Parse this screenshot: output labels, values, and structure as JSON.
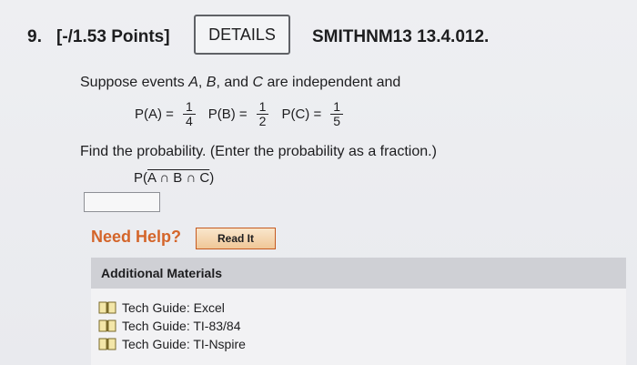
{
  "question": {
    "number": "9.",
    "points": "[-/1.53 Points]",
    "details_label": "DETAILS",
    "code": "SMITHNM13 13.4.012."
  },
  "prompt": {
    "pre": "Suppose events ",
    "A": "A",
    "sep1": ", ",
    "B": "B",
    "sep2": ", and ",
    "C": "C",
    "post": " are independent and"
  },
  "probabilities": [
    {
      "label": "P(A) =",
      "numerator": "1",
      "denominator": "4"
    },
    {
      "label": "P(B) =",
      "numerator": "1",
      "denominator": "2"
    },
    {
      "label": "P(C) =",
      "numerator": "1",
      "denominator": "5"
    }
  ],
  "instruction": "Find the probability. (Enter the probability as a fraction.)",
  "expression": {
    "prefix": "P(",
    "overlined": "A ∩ B ∩ C",
    "suffix": ")"
  },
  "answer": {
    "value": ""
  },
  "help": {
    "label": "Need Help?",
    "read_it": "Read It"
  },
  "materials": {
    "header": "Additional Materials",
    "items": [
      {
        "label": "Tech Guide: Excel",
        "icon": "book-icon"
      },
      {
        "label": "Tech Guide: TI-83/84",
        "icon": "book-icon"
      },
      {
        "label": "Tech Guide: TI-Nspire",
        "icon": "book-icon"
      }
    ]
  },
  "colors": {
    "accent": "#d4652a",
    "header_bg": "#cfd0d5"
  }
}
